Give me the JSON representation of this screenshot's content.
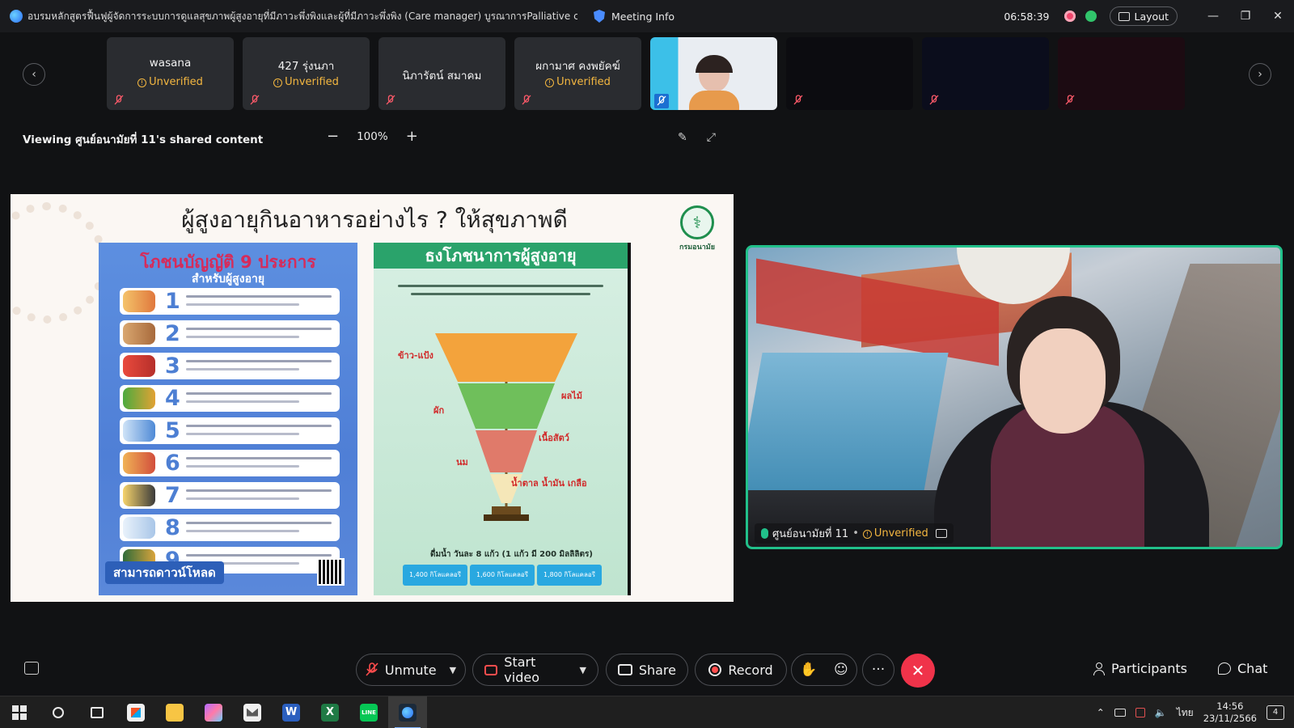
{
  "window": {
    "title": "อบรมหลักสูตรฟื้นฟูผู้จัดการระบบการดูแลสุขภาพผู้สูงอายุที่มีภาวะพึ่งพิงและผู้ที่มีภาวะพึ่งพิง (Care manager) บูรณาการPalliative c",
    "meeting_info": "Meeting Info",
    "timer": "06:58:39",
    "layout_label": "Layout",
    "minimize": "—",
    "restore": "❐",
    "close": "✕"
  },
  "participants_strip": {
    "prev_arrow": "‹",
    "next_arrow": "›",
    "tiles": [
      {
        "name": "wasana",
        "status": "Unverified"
      },
      {
        "name": "427 รุ่งนภา",
        "status": "Unverified"
      },
      {
        "name": "นิภารัตน์ สมาคม",
        "status": ""
      },
      {
        "name": "ผกามาศ คงพยัคฆ์",
        "status": "Unverified"
      },
      {
        "name": "",
        "status": ""
      },
      {
        "name": "",
        "status": ""
      },
      {
        "name": "",
        "status": ""
      },
      {
        "name": "",
        "status": ""
      }
    ]
  },
  "share_bar": {
    "viewing_text": "Viewing ศูนย์อนามัยที่ 11's shared content",
    "zoom_out": "−",
    "zoom_level": "100%",
    "zoom_in": "+",
    "annotate_icon": "✎",
    "fullscreen_icon": "⤢"
  },
  "slide": {
    "title": "ผู้สูงอายุกินอาหารอย่างไร ? ให้สุขภาพดี",
    "logo_label": "กรมอนามัย",
    "left_poster": {
      "title": "โภชนบัญญัติ 9 ประการ",
      "subtitle": "สำหรับผู้สูงอายุ",
      "numbers": [
        "1",
        "2",
        "3",
        "4",
        "5",
        "6",
        "7",
        "8",
        "9"
      ],
      "download": "สามารถดาวน์โหลด"
    },
    "right_poster": {
      "title": "ธงโภชนาการผู้สูงอายุ",
      "labels": {
        "rice": "ข้าว-แป้ง",
        "fruit": "ผลไม้",
        "veg": "ผัก",
        "meat": "เนื้อสัตว์",
        "milk": "นม",
        "sugar": "น้ำตาล น้ำมัน เกลือ"
      },
      "water": "ดื่มน้ำ วันละ 8 แก้ว (1 แก้ว มี 200 มิลลิลิตร)",
      "energy": [
        "1,400 กิโลแคลอรี",
        "1,600 กิโลแคลอรี",
        "1,800 กิโลแคลอรี"
      ]
    }
  },
  "video_tile": {
    "name": "ศูนย์อนามัยที่ 11",
    "separator": "•",
    "status": "Unverified"
  },
  "controls": {
    "unmute": "Unmute",
    "start_video": "Start video",
    "share": "Share",
    "record": "Record",
    "raise_hand_icon": "✋",
    "reactions_icon": "☺",
    "more": "···",
    "leave": "✕",
    "participants": "Participants",
    "chat": "Chat"
  },
  "taskbar": {
    "apps": [
      "windows-start",
      "search",
      "task-view",
      "store",
      "file-explorer",
      "snip",
      "mail",
      "word",
      "excel",
      "line",
      "webex"
    ],
    "word_letter": "W",
    "excel_letter": "X",
    "line_label": "LINE",
    "lang": "ไทย",
    "time": "14:56",
    "date": "23/11/2566",
    "notifications": "4"
  },
  "colors": {
    "accent_green": "#21c08a",
    "unverified": "#f4b740",
    "leave_red": "#f0334a",
    "mic_off_red": "#ff4d4d"
  }
}
